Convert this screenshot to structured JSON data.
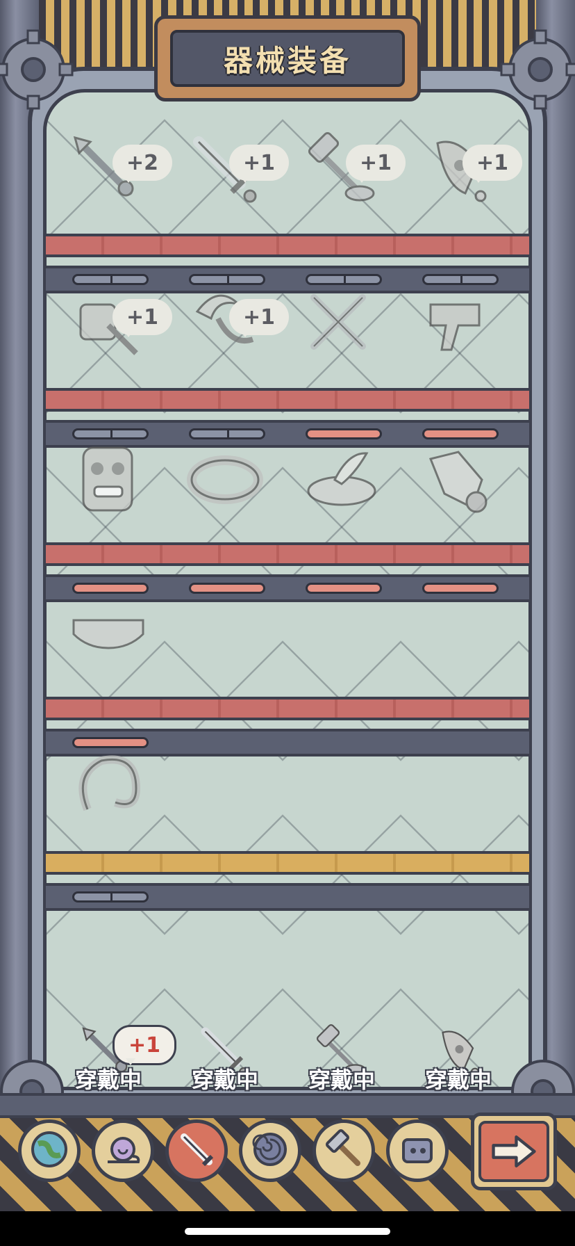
{
  "title": "器械装备",
  "colors": {
    "board_red": "#c8706c",
    "board_gold": "#d9ae5f",
    "slot_pink": "#e49184",
    "slot_dark": "#8c93a5",
    "tab_active": "#d77460",
    "tab_inactive": "#e4cf9c"
  },
  "shelves": [
    {
      "board": "red",
      "slots": [
        "dark",
        "dark",
        "dark",
        "dark"
      ],
      "items": [
        {
          "icon": "spear-icon",
          "badge": "+2"
        },
        {
          "icon": "sword-icon",
          "badge": "+1"
        },
        {
          "icon": "hammer-icon",
          "badge": "+1"
        },
        {
          "icon": "rocket-icon",
          "badge": "+1"
        }
      ]
    },
    {
      "board": "red",
      "slots": [
        "dark",
        "dark",
        "pink",
        "pink"
      ],
      "items": [
        {
          "icon": "war-hammer-icon",
          "badge": "+1"
        },
        {
          "icon": "scythe-icon",
          "badge": "+1"
        },
        {
          "icon": "crossed-blades-icon",
          "badge": ""
        },
        {
          "icon": "blaster-gun-icon",
          "badge": ""
        }
      ]
    },
    {
      "board": "red",
      "slots": [
        "pink",
        "pink",
        "pink",
        "pink"
      ],
      "items": [
        {
          "icon": "tiki-mask-icon",
          "badge": ""
        },
        {
          "icon": "ring-belt-icon",
          "badge": ""
        },
        {
          "icon": "feather-slipper-icon",
          "badge": ""
        },
        {
          "icon": "gauntlet-icon",
          "badge": ""
        }
      ]
    },
    {
      "board": "red",
      "slots": [
        "pink"
      ],
      "items": [
        {
          "icon": "visor-icon",
          "badge": ""
        }
      ]
    },
    {
      "board": "gold",
      "slots": [
        "dark"
      ],
      "items": [
        {
          "icon": "hook-icon",
          "badge": ""
        }
      ]
    }
  ],
  "equipped": [
    {
      "icon": "spear-icon",
      "label": "穿戴中",
      "badge": "+1"
    },
    {
      "icon": "sword-icon",
      "label": "穿戴中",
      "badge": ""
    },
    {
      "icon": "hammer-icon",
      "label": "穿戴中",
      "badge": ""
    },
    {
      "icon": "rocket-icon",
      "label": "穿戴中",
      "badge": ""
    }
  ],
  "tabs": [
    {
      "icon": "globe-icon",
      "active": false
    },
    {
      "icon": "snail-icon",
      "active": false
    },
    {
      "icon": "weapon-icon",
      "active": true
    },
    {
      "icon": "spiral-shell-icon",
      "active": false
    },
    {
      "icon": "hammer-tool-icon",
      "active": false
    },
    {
      "icon": "robot-icon",
      "active": false
    }
  ],
  "next_button": {
    "icon": "arrow-right-icon"
  }
}
